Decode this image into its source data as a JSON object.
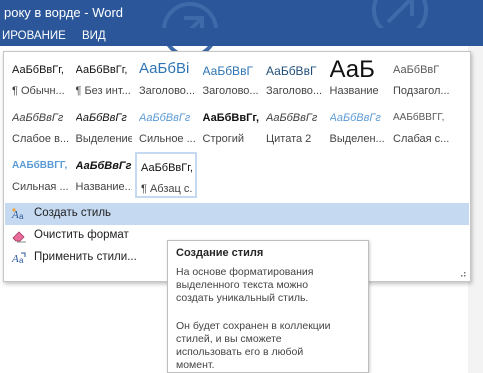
{
  "window": {
    "title": "року в ворде - Word"
  },
  "ribbon_tabs": [
    "ИРОВАНИЕ",
    "ВИД"
  ],
  "gallery": {
    "tiles": [
      {
        "preview": "АаБбВвГг,",
        "caption": "¶ Обычн...",
        "color": "#111111",
        "weight": "normal",
        "style": "normal",
        "size": "11px"
      },
      {
        "preview": "АаБбВвГг,",
        "caption": "¶ Без инт...",
        "color": "#111111",
        "weight": "normal",
        "style": "normal",
        "size": "11px"
      },
      {
        "preview": "АаБбВі",
        "caption": "Заголово...",
        "color": "#2e74b5",
        "weight": "normal",
        "style": "normal",
        "size": "15px"
      },
      {
        "preview": "АаБбВвГ",
        "caption": "Заголово...",
        "color": "#2e74b5",
        "weight": "normal",
        "style": "normal",
        "size": "12px"
      },
      {
        "preview": "АаБбВвГ",
        "caption": "Заголово...",
        "color": "#1f4d78",
        "weight": "normal",
        "style": "normal",
        "size": "12px"
      },
      {
        "preview": "АаБ",
        "caption": "Название",
        "color": "#111111",
        "weight": "normal",
        "style": "normal",
        "size": "24px"
      },
      {
        "preview": "АаБбВвГ",
        "caption": "Подзагол...",
        "color": "#595959",
        "weight": "normal",
        "style": "normal",
        "size": "11px"
      },
      {
        "preview": "АаБбВвГг",
        "caption": "Слабое в...",
        "color": "#404040",
        "weight": "normal",
        "style": "italic",
        "size": "11px"
      },
      {
        "preview": "АаБбВвГг",
        "caption": "Выделение",
        "color": "#111111",
        "weight": "normal",
        "style": "italic",
        "size": "11px"
      },
      {
        "preview": "АаБбВвГг",
        "caption": "Сильное ...",
        "color": "#5b9bd5",
        "weight": "normal",
        "style": "italic",
        "size": "11px"
      },
      {
        "preview": "АаБбВвГг,",
        "caption": "Строгий",
        "color": "#111111",
        "weight": "bold",
        "style": "normal",
        "size": "11px"
      },
      {
        "preview": "АаБбВвГг",
        "caption": "Цитата 2",
        "color": "#404040",
        "weight": "normal",
        "style": "italic",
        "size": "11px"
      },
      {
        "preview": "АаБбВвГг",
        "caption": "Выделен...",
        "color": "#5b9bd5",
        "weight": "normal",
        "style": "italic",
        "size": "11px"
      },
      {
        "preview": "ААБбВВГГ,",
        "caption": "Слабая с...",
        "color": "#595959",
        "weight": "normal",
        "style": "normal",
        "size": "10px"
      },
      {
        "preview": "ААБбВВГГ,",
        "caption": "Сильная ...",
        "color": "#5b9bd5",
        "weight": "bold",
        "style": "normal",
        "size": "10px"
      },
      {
        "preview": "АаБбВвГг",
        "caption": "Название...",
        "color": "#111111",
        "weight": "bold",
        "style": "italic",
        "size": "11px"
      },
      {
        "preview": "АаБбВвГг,",
        "caption": "¶ Абзац с...",
        "color": "#111111",
        "weight": "normal",
        "style": "normal",
        "size": "11px"
      }
    ]
  },
  "menu": {
    "create_style": "Создать стиль",
    "clear_format": "Очистить формат",
    "apply_styles": "Применить стили..."
  },
  "tooltip": {
    "title": "Создание стиля",
    "para1_line1": "На основе форматирования",
    "para1_line2": "выделенного текста можно",
    "para1_line3": "создать уникальный стиль.",
    "para2_line1": "Он будет сохранен в коллекции",
    "para2_line2": "стилей, и вы сможете",
    "para2_line3": "использовать его в любой",
    "para2_line4": "момент."
  },
  "colors": {
    "accent": "#2b579a",
    "highlight": "#c5d9f1"
  }
}
